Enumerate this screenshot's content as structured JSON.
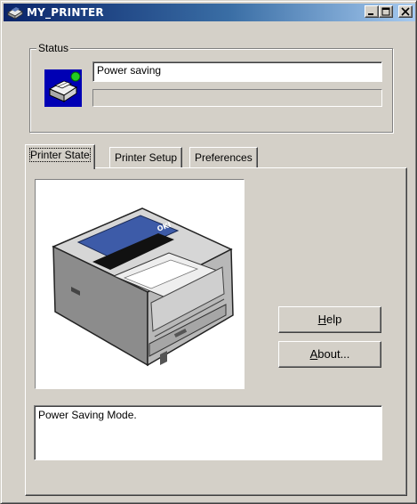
{
  "window": {
    "title": "MY_PRINTER",
    "controls": {
      "minimize": "minimize",
      "maximize": "maximize",
      "close": "close"
    }
  },
  "status": {
    "group_label": "Status",
    "text": "Power saving",
    "progress": 0
  },
  "tabs": [
    {
      "label": "Printer State",
      "active": true
    },
    {
      "label": "Printer Setup",
      "active": false
    },
    {
      "label": "Preferences",
      "active": false
    }
  ],
  "printer_state": {
    "help_button": {
      "mnemonic": "H",
      "rest": "elp"
    },
    "about_button": {
      "mnemonic": "A",
      "rest": "bout..."
    },
    "message": "Power Saving Mode."
  },
  "icons": {
    "title": "printer-icon",
    "status": "printer-status-icon",
    "illustration": "laser-printer-illustration"
  },
  "colors": {
    "titlebar_start": "#0a246a",
    "titlebar_end": "#a6caf0",
    "face": "#d4d0c8",
    "status_led": "#22cc22"
  }
}
